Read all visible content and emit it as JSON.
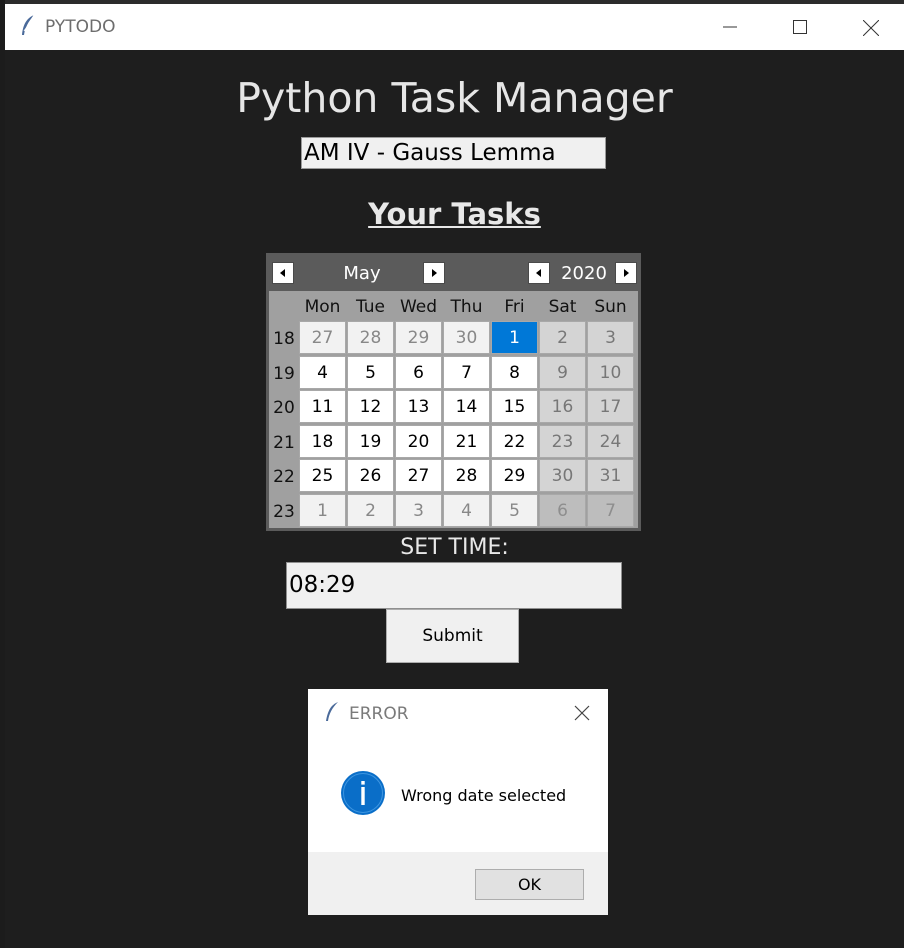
{
  "window": {
    "title": "PYTODO"
  },
  "app": {
    "heading": "Python Task Manager",
    "task_value": "AM IV - Gauss Lemma",
    "section_title": "Your Tasks",
    "set_time_label": "SET TIME:",
    "time_value": "08:29",
    "submit_label": "Submit"
  },
  "calendar": {
    "month": "May",
    "year": "2020",
    "weekdays": [
      "Mon",
      "Tue",
      "Wed",
      "Thu",
      "Fri",
      "Sat",
      "Sun"
    ],
    "weeks": [
      {
        "num": "18",
        "days": [
          [
            "27",
            "other"
          ],
          [
            "28",
            "other"
          ],
          [
            "29",
            "other"
          ],
          [
            "30",
            "other"
          ],
          [
            "1",
            "selected"
          ],
          [
            "2",
            "weekend"
          ],
          [
            "3",
            "weekend"
          ]
        ]
      },
      {
        "num": "19",
        "days": [
          [
            "4",
            "normal"
          ],
          [
            "5",
            "normal"
          ],
          [
            "6",
            "normal"
          ],
          [
            "7",
            "normal"
          ],
          [
            "8",
            "normal"
          ],
          [
            "9",
            "weekend"
          ],
          [
            "10",
            "weekend"
          ]
        ]
      },
      {
        "num": "20",
        "days": [
          [
            "11",
            "normal"
          ],
          [
            "12",
            "normal"
          ],
          [
            "13",
            "normal"
          ],
          [
            "14",
            "normal"
          ],
          [
            "15",
            "normal"
          ],
          [
            "16",
            "weekend"
          ],
          [
            "17",
            "weekend"
          ]
        ]
      },
      {
        "num": "21",
        "days": [
          [
            "18",
            "normal"
          ],
          [
            "19",
            "normal"
          ],
          [
            "20",
            "normal"
          ],
          [
            "21",
            "normal"
          ],
          [
            "22",
            "normal"
          ],
          [
            "23",
            "weekend"
          ],
          [
            "24",
            "weekend"
          ]
        ]
      },
      {
        "num": "22",
        "days": [
          [
            "25",
            "normal"
          ],
          [
            "26",
            "normal"
          ],
          [
            "27",
            "normal"
          ],
          [
            "28",
            "normal"
          ],
          [
            "29",
            "normal"
          ],
          [
            "30",
            "weekend"
          ],
          [
            "31",
            "weekend"
          ]
        ]
      },
      {
        "num": "23",
        "days": [
          [
            "1",
            "other"
          ],
          [
            "2",
            "other"
          ],
          [
            "3",
            "other"
          ],
          [
            "4",
            "other"
          ],
          [
            "5",
            "other"
          ],
          [
            "6",
            "weekend-other"
          ],
          [
            "7",
            "weekend-other"
          ]
        ]
      }
    ],
    "selected_color": "#0078d7"
  },
  "dialog": {
    "title": "ERROR",
    "message": "Wrong date selected",
    "ok_label": "OK",
    "icon": "info-icon"
  }
}
